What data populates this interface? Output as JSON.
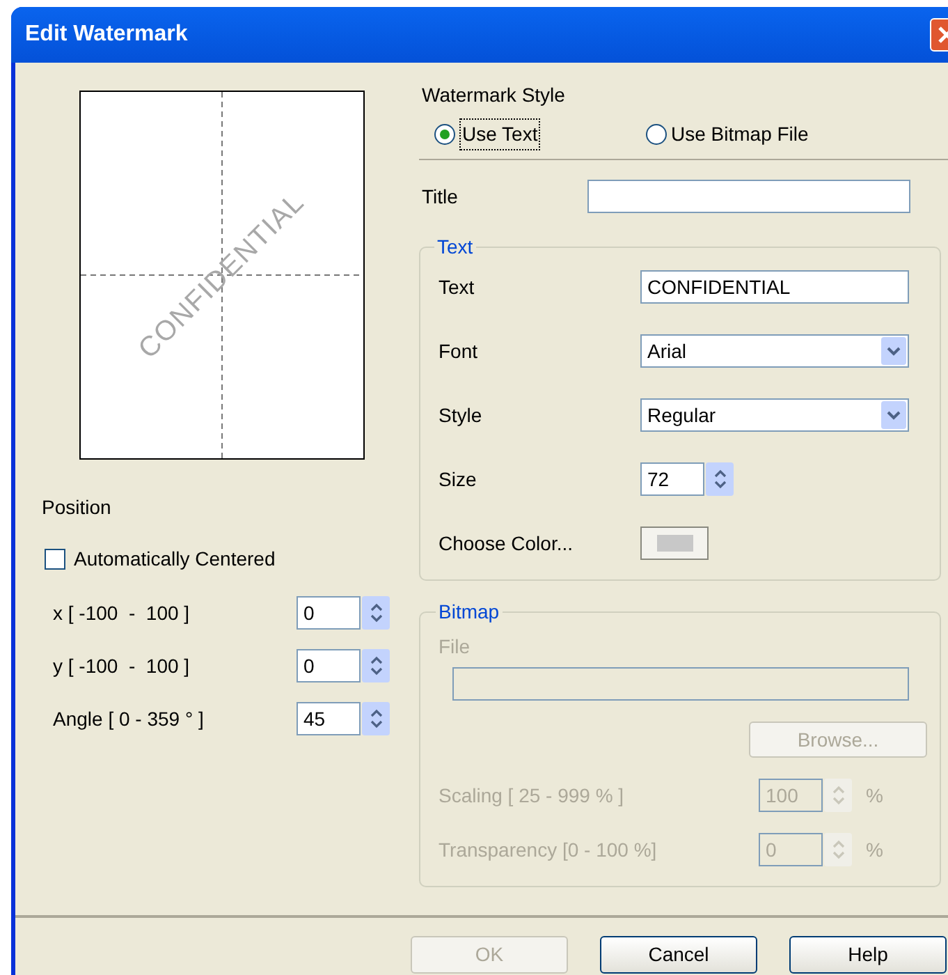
{
  "window": {
    "title": "Edit Watermark"
  },
  "preview": {
    "text": "CONFIDENTIAL"
  },
  "position": {
    "label": "Position",
    "auto_centered": {
      "label": "Automatically Centered",
      "checked": false
    },
    "fields": [
      {
        "label": "x [ -100  -  100 ]",
        "value": "0"
      },
      {
        "label": "y [ -100  -  100 ]",
        "value": "0"
      },
      {
        "label": "Angle [ 0 - 359 ° ]",
        "value": "45"
      }
    ]
  },
  "watermark_style": {
    "label": "Watermark Style",
    "options": [
      {
        "label": "Use Text",
        "selected": true
      },
      {
        "label": "Use Bitmap File",
        "selected": false
      }
    ]
  },
  "title_field": {
    "label": "Title"
  },
  "text_group": {
    "legend": "Text",
    "rows": [
      {
        "kind": "input",
        "label": "Text",
        "value": "CONFIDENTIAL"
      },
      {
        "kind": "select",
        "label": "Font",
        "value": "Arial"
      },
      {
        "kind": "select",
        "label": "Style",
        "value": "Regular"
      },
      {
        "kind": "spin",
        "label": "Size",
        "value": "72"
      },
      {
        "kind": "color",
        "label": "Choose Color..."
      }
    ]
  },
  "bitmap_group": {
    "legend": "Bitmap",
    "disabled": true,
    "file_label": "File",
    "browse": "Browse...",
    "spins": [
      {
        "label": "Scaling [ 25 - 999 % ]",
        "value": "100",
        "unit": "%"
      },
      {
        "label": "Transparency [0 - 100 %]",
        "value": "0",
        "unit": "%"
      }
    ]
  },
  "buttons": [
    {
      "label": "OK",
      "disabled": true
    },
    {
      "label": "Cancel",
      "disabled": false
    },
    {
      "label": "Help",
      "disabled": false
    }
  ]
}
